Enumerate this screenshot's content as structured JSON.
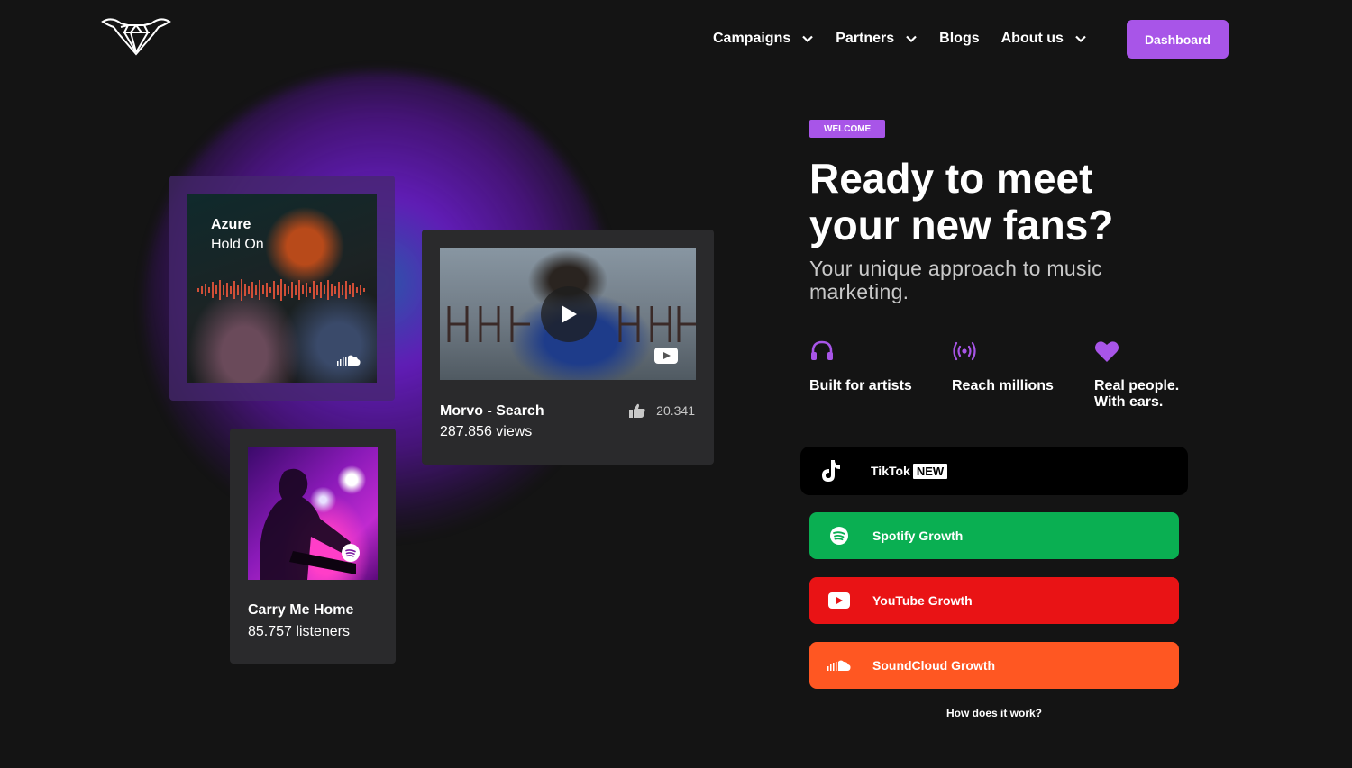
{
  "header": {
    "logo_icon": "diamond-wings-logo",
    "nav": [
      {
        "label": "Campaigns",
        "has_dropdown": true
      },
      {
        "label": "Partners",
        "has_dropdown": true
      },
      {
        "label": "Blogs",
        "has_dropdown": false
      },
      {
        "label": "About us",
        "has_dropdown": true
      }
    ],
    "dashboard_label": "Dashboard"
  },
  "cards": {
    "soundcloud": {
      "title": "Azure",
      "subtitle": "Hold On",
      "icon": "soundcloud-icon"
    },
    "youtube": {
      "title": "Morvo - Search",
      "views": "287.856 views",
      "likes": "20.341",
      "icon": "youtube-icon"
    },
    "spotify": {
      "title": "Carry Me Home",
      "listeners": "85.757 listeners",
      "icon": "spotify-icon"
    }
  },
  "hero": {
    "badge": "WELCOME",
    "title": "Ready to meet your new fans?",
    "subtitle": "Your unique approach to music marketing.",
    "features": [
      {
        "label": "Built for artists",
        "icon": "headphones-icon"
      },
      {
        "label": "Reach millions",
        "icon": "broadcast-icon"
      },
      {
        "label": "Real people. With ears.",
        "icon": "heart-icon"
      }
    ]
  },
  "platforms": {
    "tiktok": {
      "label": "TikTok",
      "tag": "NEW"
    },
    "spotify": {
      "label": "Spotify Growth"
    },
    "youtube": {
      "label": "YouTube Growth"
    },
    "soundcloud": {
      "label": "SoundCloud Growth"
    }
  },
  "how_link": "How does it work?",
  "colors": {
    "accent": "#a855e8",
    "background": "#141414",
    "spotify": "#0aaf52",
    "youtube": "#e91315",
    "soundcloud": "#ff5722",
    "tiktok": "#000000"
  }
}
